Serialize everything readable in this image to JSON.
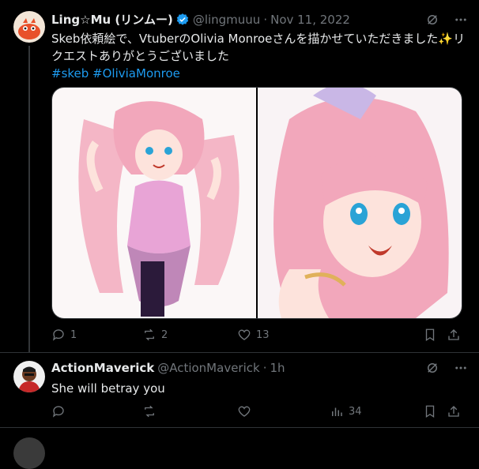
{
  "tweet1": {
    "name": "Ling☆Mu (リンムー)",
    "handle": "@lingmuuu",
    "separator": "·",
    "date": "Nov 11, 2022",
    "text_line1": "Skeb依頼絵で、VtuberのOlivia Monroeさんを描かせていただきました✨リ",
    "text_line2": "クエストありがとうございました",
    "hashtags": "#skeb #OliviaMonroe",
    "replies": "1",
    "retweets": "2",
    "likes": "13",
    "views": ""
  },
  "tweet2": {
    "name": "ActionMaverick",
    "handle": "@ActionMaverick",
    "separator": "·",
    "date": "1h",
    "text": "She will betray you",
    "replies": "",
    "retweets": "",
    "likes": "",
    "views": "34"
  },
  "colors": {
    "background": "#000000",
    "text": "#e7e9ea",
    "muted": "#71767b",
    "link": "#1d9bf0",
    "verified": "#1d9bf0"
  }
}
